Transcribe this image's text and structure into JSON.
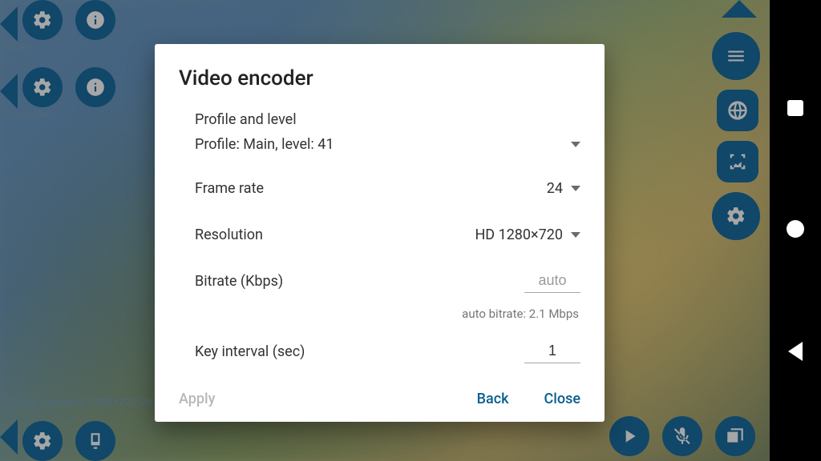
{
  "background": {
    "label_rtsp": "RTSP",
    "label_recorder": "Recorder",
    "status_line": "Device cameras 1280×720  28.7"
  },
  "dialog": {
    "title": "Video encoder",
    "profile_section_label": "Profile and level",
    "profile_value": "Profile: Main, level: 41",
    "frame_rate_label": "Frame rate",
    "frame_rate_value": "24",
    "resolution_label": "Resolution",
    "resolution_value": "HD 1280×720",
    "bitrate_label": "Bitrate (Kbps)",
    "bitrate_placeholder": "auto",
    "bitrate_hint": "auto bitrate: 2.1 Mbps",
    "key_interval_label": "Key interval (sec)",
    "key_interval_value": "1",
    "apply_label": "Apply",
    "back_label": "Back",
    "close_label": "Close"
  }
}
